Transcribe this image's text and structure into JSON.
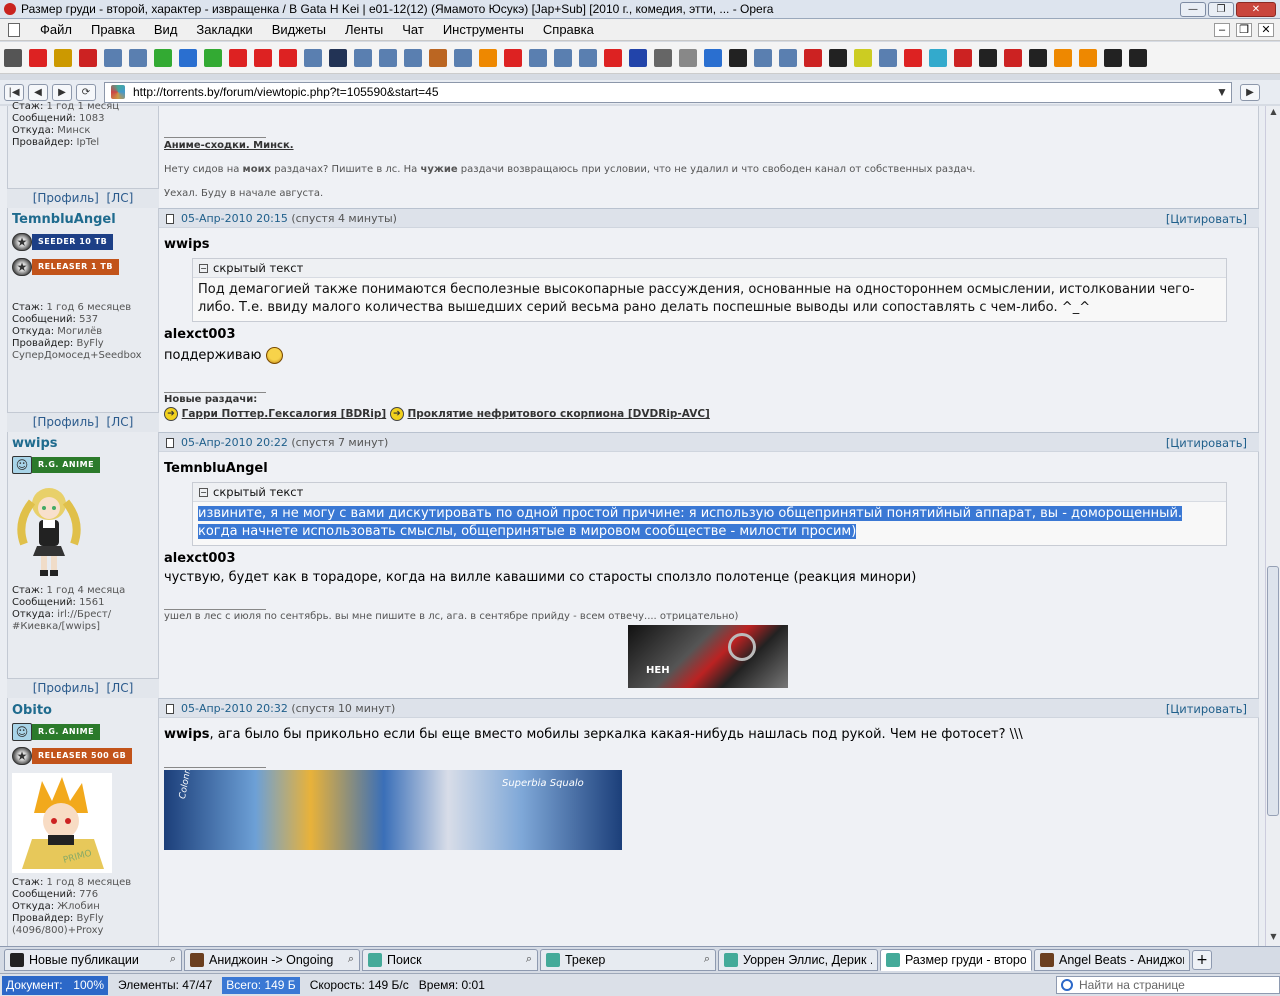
{
  "window": {
    "title": "Размер груди - второй, характер - извращенка / B Gata H Kei | e01-12(12) (Ямамото Юсукэ) [Jap+Sub] [2010 г., комедия, этти, ... - Opera"
  },
  "menu": [
    "Файл",
    "Правка",
    "Вид",
    "Закладки",
    "Виджеты",
    "Ленты",
    "Чат",
    "Инструменты",
    "Справка"
  ],
  "address": {
    "url": "http://torrents.by/forum/viewtopic.php?t=105590&start=45"
  },
  "first_post_tail": {
    "user_stats": [
      [
        "Стаж:",
        "1 год 1 месяц"
      ],
      [
        "Сообщений:",
        "1083"
      ],
      [
        "Откуда:",
        "Минск"
      ],
      [
        "Провайдер:",
        "IpTel"
      ]
    ],
    "sig_title": "Аниме-сходки. Минск.",
    "sig_line1_pre": "Нету сидов на ",
    "sig_line1_b1": "моих",
    "sig_line1_mid": " раздачах? Пишите в лс. На ",
    "sig_line1_b2": "чужие",
    "sig_line1_post": " раздачи возвращаюсь при условии, что не удалил и что свободен канал от собственных раздач.",
    "sig_line2": "Уехал. Буду в начале августа."
  },
  "profile_links": {
    "profile": "[Профиль]",
    "pm": "[ЛС]"
  },
  "quote_label": "[Цитировать]",
  "spoiler_label": "скрытый текст",
  "posts": [
    {
      "author": "TemnbluAngel",
      "ranks": [
        "SEEDER 10 TB",
        "RELEASER 1 TB"
      ],
      "rank_colors": [
        "#1d3f86",
        "#c2531a"
      ],
      "stats": [
        [
          "Стаж:",
          "1 год 6 месяцев"
        ],
        [
          "Сообщений:",
          "537"
        ],
        [
          "Откуда:",
          "Могилёв"
        ],
        [
          "Провайдер:",
          "ByFly"
        ],
        [
          "",
          "СуперДомосед+Seedbox"
        ]
      ],
      "date": "05-Апр-2010 20:15",
      "ago": "(спустя 4 минуты)",
      "quote1_author": "wwips",
      "spoiler1": "Под демагогией также понимаются бесполезные высокопарные рассуждения, основанные на одностороннем осмыслении, истолковании чего-либо. Т.е. ввиду малого количества вышедших серий весьма рано делать поспешные выводы или сопоставлять с чем-либо. ^_^",
      "quote2_author": "alexct003",
      "text2": "поддерживаю",
      "sig_title": "Новые раздачи:",
      "sig_link1": "Гарри Поттер.Гексалогия [BDRip]",
      "sig_link2": "Проклятие нефритового скорпиона [DVDRip-AVC]"
    },
    {
      "author": "wwips",
      "ranks": [
        "R.G. ANIME"
      ],
      "rank_colors": [
        "#2b7a2b"
      ],
      "stats": [
        [
          "Стаж:",
          "1 год 4 месяца"
        ],
        [
          "Сообщений:",
          "1561"
        ],
        [
          "Откуда:",
          "irl://Брест/"
        ],
        [
          "",
          "#Киевка/[wwips]"
        ]
      ],
      "date": "05-Апр-2010 20:22",
      "ago": "(спустя 7 минут)",
      "quote1_author": "TemnbluAngel",
      "spoiler1": "извините, я не могу с вами дискутировать по одной простой причине: я использую общепринятый понятийный аппарат, вы - доморощенный. когда начнете использовать смыслы, общепринятые в мировом сообществе - милости просим)",
      "quote2_author": "alexct003",
      "text2": "чуствую, будет как в торадоре, когда на вилле кавашими со старосты сползло полотенце (реакция минори)",
      "sig_text": "ушел в лес с июля по сентябрь. вы мне пишите в лс, ага. в сентябре прийду - всем отвечу.... отрицательно)",
      "sig_image_text": "НЕН"
    },
    {
      "author": "Obito",
      "ranks": [
        "R.G. ANIME",
        "RELEASER 500 GB"
      ],
      "rank_colors": [
        "#2b7a2b",
        "#c2531a"
      ],
      "stats": [
        [
          "Стаж:",
          "1 год 8 месяцев"
        ],
        [
          "Сообщений:",
          "776"
        ],
        [
          "Откуда:",
          "Жлобин"
        ],
        [
          "Провайдер:",
          "ByFly"
        ],
        [
          "",
          "(4096/800)+Proxy"
        ]
      ],
      "date": "05-Апр-2010 20:32",
      "ago": "(спустя 10 минут)",
      "text_b": "wwips",
      "text": ", ага было бы прикольно если бы еще вместо мобилы зеркалка какая-нибудь нашлась под рукой. Чем не фотосет? \\\\\\",
      "banner_text1": "Colonnello",
      "banner_text2": "Superbia Squalo",
      "avatar_text": "PRIMO"
    }
  ],
  "tabs": [
    {
      "label": "Новые публикации",
      "icon": "#222"
    },
    {
      "label": "Аниджоин -> Ongoing",
      "icon": "#6b3f1f"
    },
    {
      "label": "Поиск",
      "icon": "#4a9"
    },
    {
      "label": "Трекер",
      "icon": "#4a9"
    },
    {
      "label": "Уоррен Эллис, Дерик ...",
      "icon": "#4a9"
    },
    {
      "label": "Размер груди - второ...",
      "icon": "#4a9",
      "active": true
    },
    {
      "label": "Angel Beats - Аниджоин",
      "icon": "#6b3f1f"
    }
  ],
  "status": {
    "doc_label": "Документ:",
    "doc_value": "100%",
    "elements_label": "Элементы:",
    "elements_value": "47/47",
    "total_label": "Всего:",
    "total_value": "149 Б",
    "speed_label": "Скорость:",
    "speed_value": "149 Б/с",
    "time_label": "Время:",
    "time_value": "0:01",
    "find_placeholder": "Найти на странице"
  },
  "bookmark_colors": [
    "#555",
    "#d22",
    "#c90",
    "#c22",
    "#5a7fb0",
    "#5a7fb0",
    "#3a3",
    "#2a6fd0",
    "#3a3",
    "#d22",
    "#d22",
    "#d22",
    "#5a7fb0",
    "#235",
    "#5a7fb0",
    "#5a7fb0",
    "#5a7fb0",
    "#b62",
    "#5a7fb0",
    "#e80",
    "#d22",
    "#5a7fb0",
    "#5a7fb0",
    "#5a7fb0",
    "#d22",
    "#24a",
    "#666",
    "#888",
    "#2a6fd0",
    "#222",
    "#5a7fb0",
    "#5a7fb0",
    "#c22",
    "#222",
    "#cc2",
    "#5a7fb0",
    "#d22",
    "#3ac",
    "#c22",
    "#222",
    "#c22",
    "#222",
    "#e80",
    "#e80",
    "#222",
    "#222"
  ]
}
